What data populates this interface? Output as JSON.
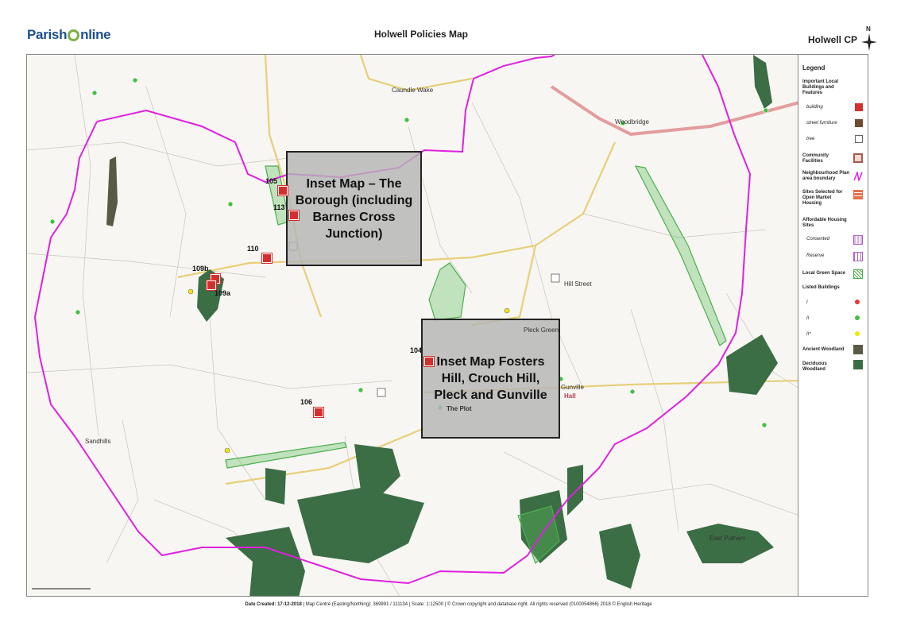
{
  "header": {
    "brand_pre": "Parish",
    "brand_post": "nline",
    "title": "Holwell Policies Map",
    "parish": "Holwell CP",
    "north_label": "N"
  },
  "legend": {
    "title": "Legend",
    "sections": {
      "important": "Important Local Buildings and Features",
      "community": "Community Facilities",
      "neighbourhood": "Neighbourhood Plan area boundary",
      "sites_open": "Sites Selected for Open Market Housing",
      "affordable": "Affordable Housing Sites",
      "green_space": "Local Green Space",
      "listed": "Listed Buildings",
      "ancient": "Ancient Woodland",
      "deciduous": "Deciduous Woodland"
    },
    "items": {
      "building": "building",
      "street_furniture": "street furniture",
      "tree": "tree",
      "consented": "Consented",
      "reserve": "Reserve",
      "grade_1": "I",
      "grade_2": "II",
      "grade_2star": "II*"
    },
    "colors": {
      "building": "#d32f2f",
      "street_furniture": "#6d4c2f",
      "boundary": "#e020e0",
      "sites_open": "#e8704a",
      "affordable": "#b060c8",
      "green_space": "#4caf50",
      "listed_1": "#e53935",
      "listed_2": "#43c043",
      "listed_2star": "#f2e600",
      "ancient": "#5a5a44",
      "deciduous": "#3b6e44"
    }
  },
  "insets": {
    "borough": "Inset Map – The Borough (including Barnes Cross Junction)",
    "fosters": "Inset Map Fosters Hill, Crouch Hill, Pleck and Gunville"
  },
  "sites": {
    "s105": "105",
    "s113": "113",
    "s110": "110",
    "s109b": "109b",
    "s109a": "109a",
    "s104": "104",
    "s106": "106"
  },
  "places": {
    "caundle_wake": "Caundle Wake",
    "hill_street": "Hill Street",
    "pleck_green": "Pleck Green",
    "sandhills": "Sandhills",
    "east_pulham": "East Pulham",
    "the_plot": "The Plot",
    "hall": "Hall",
    "gunville": "Gunville",
    "bishops_road": "Woodbridge"
  },
  "footer": {
    "date_label": "Date Created:",
    "date_value": "17-12-2018",
    "rest": " | Map Centre (Easting/Northing): 369991 / 111134 | Scale: 1:12500 | © Crown copyright and database right. All rights reserved (0100054866) 2018 © English Heritage"
  }
}
